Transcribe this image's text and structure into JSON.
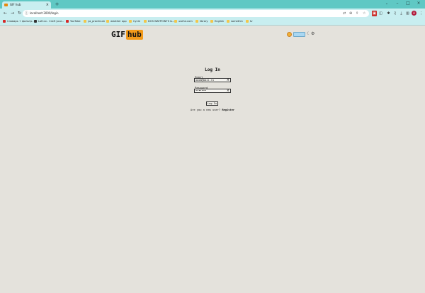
{
  "browser": {
    "tab_title": "GIF hub",
    "url": "localhost:3000/login",
    "tab_close": "×",
    "new_tab": "+",
    "window_controls": {
      "chevron": "⌄",
      "minimize": "–",
      "maximize": "□",
      "close": "×"
    },
    "nav": {
      "back": "←",
      "forward": "→",
      "reload": "↻"
    },
    "profile_initial": "A"
  },
  "bookmarks": [
    {
      "label": "Словарь + фильтр..",
      "icon": "red"
    },
    {
      "label": "Lofi.co - Craft your...",
      "icon": "dark"
    },
    {
      "label": "YouTube",
      "icon": "red"
    },
    {
      "label": "ya_practicum",
      "icon": "folder"
    },
    {
      "label": "weather app",
      "icon": "folder"
    },
    {
      "label": "Cycle",
      "icon": "folder"
    },
    {
      "label": "DOS WAYPOINTS &...",
      "icon": "folder"
    },
    {
      "label": "useful.com",
      "icon": "folder"
    },
    {
      "label": "library",
      "icon": "folder"
    },
    {
      "label": "English",
      "icon": "folder"
    },
    {
      "label": "somethin",
      "icon": "folder"
    },
    {
      "label": "tv",
      "icon": "folder"
    }
  ],
  "header": {
    "logo_left": "GIF",
    "logo_right": "hub",
    "moon": "☾",
    "settings": "⚙"
  },
  "login": {
    "title": "Log In",
    "email_label": "Email",
    "email_value": "ooom@mail.ru",
    "password_label": "Password",
    "password_value": "•••••••",
    "clear_glyph": "×",
    "submit_label": "Log In",
    "new_user_prompt": "Are you a new user?",
    "register_label": "Register"
  },
  "colors": {
    "tabbar": "#5fc8c4",
    "toolbar": "#c8eef0",
    "page_bg": "#e4e2dc",
    "logo_accent": "#f29a1a"
  }
}
